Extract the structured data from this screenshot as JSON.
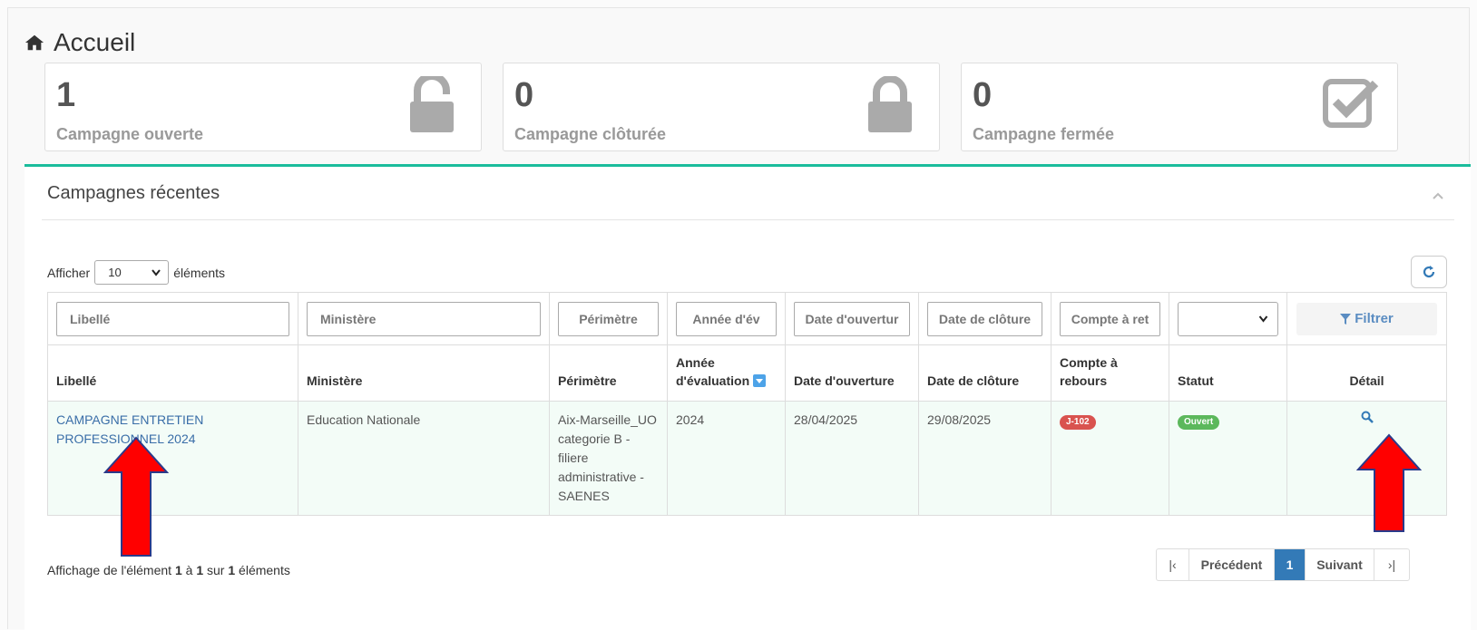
{
  "page": {
    "title": "Accueil"
  },
  "stats": [
    {
      "value": "1",
      "label": "Campagne ouverte",
      "icon": "unlock-icon"
    },
    {
      "value": "0",
      "label": "Campagne clôturée",
      "icon": "lock-icon"
    },
    {
      "value": "0",
      "label": "Campagne fermée",
      "icon": "checkbox-icon"
    }
  ],
  "panel": {
    "title": "Campagnes récentes",
    "show_prefix": "Afficher",
    "show_value": "10",
    "show_suffix": "éléments"
  },
  "filters": {
    "libelle": "Libellé",
    "ministere": "Ministère",
    "perimetre": "Périmètre",
    "annee": "Année d'év",
    "date_ouverture": "Date d'ouvertur",
    "date_cloture": "Date de clôture",
    "compte": "Compte à ret",
    "filtrer": "Filtrer"
  },
  "columns": {
    "libelle": "Libellé",
    "ministere": "Ministère",
    "perimetre": "Périmètre",
    "annee_1": "Année",
    "annee_2": "d'évaluation",
    "date_ouverture": "Date d'ouverture",
    "date_cloture": "Date de clôture",
    "compte_1": "Compte à",
    "compte_2": "rebours",
    "statut": "Statut",
    "detail": "Détail"
  },
  "rows": [
    {
      "libelle_1": "CAMPAGNE ENTRETIEN",
      "libelle_2": "PROFESSIONNEL 2024",
      "ministere": "Education Nationale",
      "perimetre_1": "Aix-Marseille_UO",
      "perimetre_2": "categorie B -",
      "perimetre_3": "filiere",
      "perimetre_4": "administrative -",
      "perimetre_5": "SAENES",
      "annee": "2024",
      "date_ouverture": "28/04/2025",
      "date_cloture": "29/08/2025",
      "compte": "J-102",
      "statut": "Ouvert"
    }
  ],
  "info": {
    "prefix": "Affichage de l'élément",
    "from": "1",
    "mid": "à",
    "to": "1",
    "mid2": "sur",
    "total": "1",
    "suffix": "éléments"
  },
  "pagination": {
    "first": "|‹",
    "prev": "Précédent",
    "current": "1",
    "next": "Suivant",
    "last": "›|"
  },
  "colors": {
    "accent": "#1abc9c",
    "link": "#3a6ea8",
    "badge_red": "#d9534f",
    "badge_green": "#5cb85c",
    "page_active": "#337ab7",
    "arrow": "#ff0000"
  }
}
